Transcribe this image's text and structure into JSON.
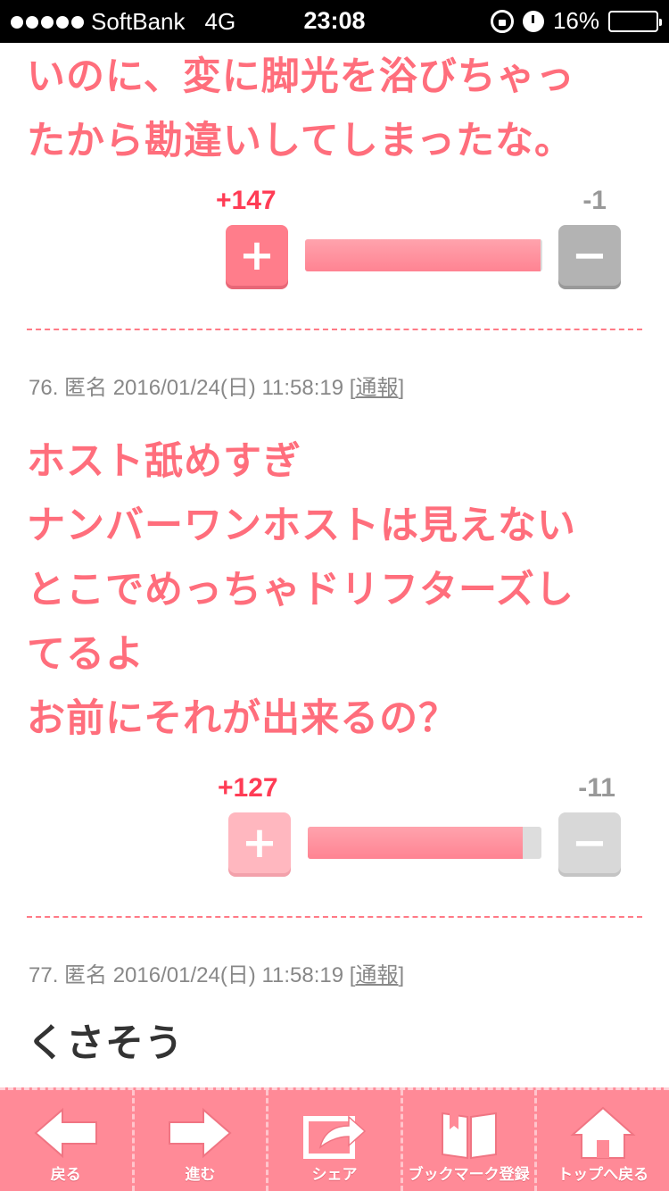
{
  "status_bar": {
    "carrier": "SoftBank",
    "network": "4G",
    "time": "23:08",
    "battery": "16%"
  },
  "comments": [
    {
      "lines": [
        "いのに、変に脚光を浴びちゃっ",
        "たから勘違いしてしまったな。"
      ],
      "plus": "+147",
      "minus": "-1",
      "plus_ratio": 0.993
    },
    {
      "meta": "76. 匿名 2016/01/24(日) 11:58:19",
      "report": "通報",
      "lines": [
        "ホスト舐めすぎ",
        "ナンバーワンホストは見えない",
        "とこでめっちゃドリフターズし",
        "てるよ",
        "お前にそれが出来るの？"
      ],
      "plus": "+127",
      "minus": "-11",
      "plus_ratio": 0.92
    },
    {
      "meta": "77. 匿名 2016/01/24(日) 11:58:19",
      "report": "通報",
      "lines": [
        "くさそう"
      ]
    }
  ],
  "vote_button": {
    "plus_symbol": "+",
    "minus_symbol": "−"
  },
  "toolbar": {
    "back": "戻る",
    "forward": "進む",
    "share": "シェア",
    "bookmark": "ブックマーク登録",
    "top": "トップへ戻る"
  }
}
